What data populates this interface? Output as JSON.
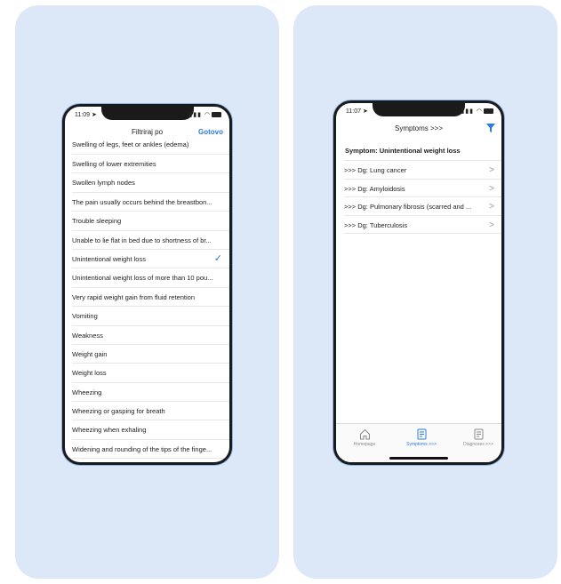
{
  "left_phone": {
    "status": {
      "time": "11:09 ➤"
    },
    "nav": {
      "title": "Filtriraj po",
      "done": "Gotovo"
    },
    "items": [
      {
        "label": "Swelling of legs, feet or ankles (edema)",
        "checked": false
      },
      {
        "label": "Swelling of lower extremities",
        "checked": false
      },
      {
        "label": "Swollen lymph nodes",
        "checked": false
      },
      {
        "label": "The pain usually occurs behind the breastbon...",
        "checked": false
      },
      {
        "label": "Trouble sleeping",
        "checked": false
      },
      {
        "label": "Unable to lie flat in bed due to shortness of br...",
        "checked": false
      },
      {
        "label": "Unintentional weight loss",
        "checked": true
      },
      {
        "label": "Unintentional weight loss of more than 10 pou...",
        "checked": false
      },
      {
        "label": "Very rapid weight gain from fluid retention",
        "checked": false
      },
      {
        "label": "Vomiting",
        "checked": false
      },
      {
        "label": "Weakness",
        "checked": false
      },
      {
        "label": "Weight gain",
        "checked": false
      },
      {
        "label": "Weight loss",
        "checked": false
      },
      {
        "label": "Wheezing",
        "checked": false
      },
      {
        "label": "Wheezing or gasping for breath",
        "checked": false
      },
      {
        "label": "Wheezing when exhaling",
        "checked": false
      },
      {
        "label": "Widening and rounding of the tips of the finge...",
        "checked": false
      }
    ]
  },
  "right_phone": {
    "status": {
      "time": "11:07 ➤"
    },
    "nav": {
      "title": "Symptoms >>>"
    },
    "symptom_heading": "Symptom: Unintentional weight loss",
    "diagnoses": [
      ">>> Dg: Lung cancer",
      ">>> Dg: Amyloidosis",
      ">>> Dg: Pulmonary fibrosis (scarred and ...",
      ">>> Dg: Tuberculosis"
    ],
    "tabs": [
      {
        "label": "Homepage",
        "icon": "home-icon",
        "active": false
      },
      {
        "label": "Symptoms >>>",
        "icon": "symptoms-icon",
        "active": true
      },
      {
        "label": "Diagnoses >>>",
        "icon": "diagnoses-icon",
        "active": false
      }
    ]
  },
  "colors": {
    "accent": "#2a7be4",
    "panel": "#dce8f7"
  }
}
